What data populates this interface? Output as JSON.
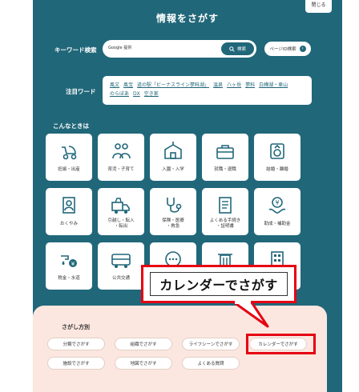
{
  "header": {
    "title": "情報をさがす",
    "close_label": "閉じる"
  },
  "search": {
    "label": "キーワード検索",
    "placeholder": "Google 提供",
    "button_label": "検索",
    "page_id_label": "ページID検索"
  },
  "keywords": {
    "label": "注目ワード",
    "items": [
      "風文",
      "風宝",
      "道の駅「ビーナスライン蓼科湖」",
      "温泉",
      "八ヶ岳",
      "蓼科",
      "白樺湖・車山",
      "のらぼあ",
      "DX",
      "空き家"
    ]
  },
  "situations": {
    "label": "こんなときは",
    "tiles": [
      {
        "label": "妊娠・出産",
        "icon": "stroller-icon"
      },
      {
        "label": "育児・子育て",
        "icon": "family-icon"
      },
      {
        "label": "入園・入学",
        "icon": "school-icon"
      },
      {
        "label": "就職・退職",
        "icon": "briefcase-icon"
      },
      {
        "label": "結婚・離婚",
        "icon": "ring-icon"
      },
      {
        "label": "おくやみ",
        "icon": "memorial-icon"
      },
      {
        "label": "引越し・転入\n・転出",
        "icon": "moving-truck-icon"
      },
      {
        "label": "保険・医療\n・救急",
        "icon": "stethoscope-icon"
      },
      {
        "label": "よくある手続き\n・証明書",
        "icon": "document-icon"
      },
      {
        "label": "助成・補助金",
        "icon": "subsidy-icon"
      },
      {
        "label": "税金・水道",
        "icon": "tax-water-icon"
      },
      {
        "label": "公共交通",
        "icon": "bus-icon"
      },
      {
        "label": "",
        "icon": "chat-icon"
      },
      {
        "label": "",
        "icon": "trash-icon"
      },
      {
        "label": "",
        "icon": "building-icon"
      }
    ]
  },
  "callout": {
    "text": "カレンダーでさがす"
  },
  "methods": {
    "title": "さがし方別",
    "items": [
      "分類でさがす",
      "組織でさがす",
      "ライフシーンでさがす",
      "カレンダーでさがす",
      "施設でさがす",
      "地図でさがす",
      "よくある質問"
    ]
  },
  "colors": {
    "panel": "#21677a",
    "highlight": "#e60012",
    "methods_bg": "#fbe7df"
  }
}
